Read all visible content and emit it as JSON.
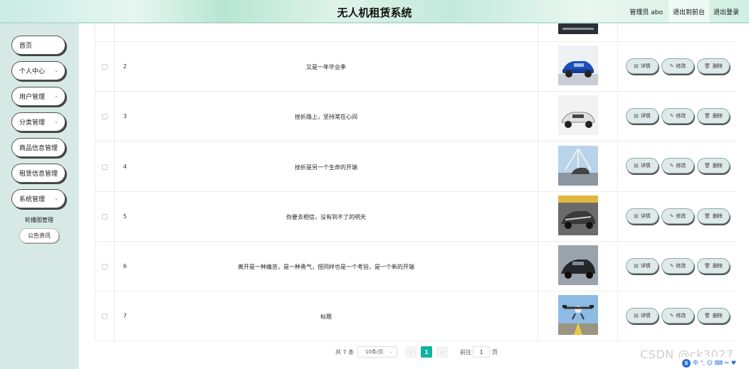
{
  "header": {
    "title": "无人机租赁系统",
    "user": "管理员 abo",
    "to_front": "退出到前台",
    "logout": "退出登录"
  },
  "sidebar": {
    "items": [
      {
        "label": "首页",
        "has_children": false
      },
      {
        "label": "个人中心",
        "has_children": true
      },
      {
        "label": "用户管理",
        "has_children": true
      },
      {
        "label": "分类管理",
        "has_children": true
      },
      {
        "label": "商品信息管理",
        "has_children": false
      },
      {
        "label": "租赁信息管理",
        "has_children": false
      },
      {
        "label": "系统管理",
        "has_children": true
      }
    ],
    "subitems": [
      {
        "label": "轮播图管理"
      },
      {
        "label": "公告资讯"
      }
    ]
  },
  "table": {
    "actions": {
      "detail": "详情",
      "edit": "修改",
      "delete": "删除"
    },
    "rows": [
      {
        "index": "2",
        "title": "又是一年毕业季",
        "thumb_color": "#1d4fb8"
      },
      {
        "index": "3",
        "title": "挫折路上，坚持常在心间",
        "thumb_color": "#e6e6e6"
      },
      {
        "index": "4",
        "title": "挫折是另一个生命的开端",
        "thumb_color": "#7ea7c9"
      },
      {
        "index": "5",
        "title": "你要去相信，没有到不了的明天",
        "thumb_color": "#555555"
      },
      {
        "index": "6",
        "title": "离开是一种痛苦，是一种勇气，但同样也是一个考验，是一个新的开端",
        "thumb_color": "#2e3035"
      },
      {
        "index": "7",
        "title": "标题",
        "thumb_color": "#6fa8d8"
      }
    ]
  },
  "pagination": {
    "total": "共 7 条",
    "page_size": "10条/页",
    "current": "1",
    "goto_label": "前往",
    "goto_value": "1",
    "page_suffix": "页"
  },
  "watermark": "CSDN @ck3027",
  "ime": {
    "logo": "S",
    "text": "中 °, ☺ ⌨ ✂ ♥"
  },
  "colors": {
    "accent": "#10b3a0",
    "sidebar_bg": "#d6e9e5"
  }
}
